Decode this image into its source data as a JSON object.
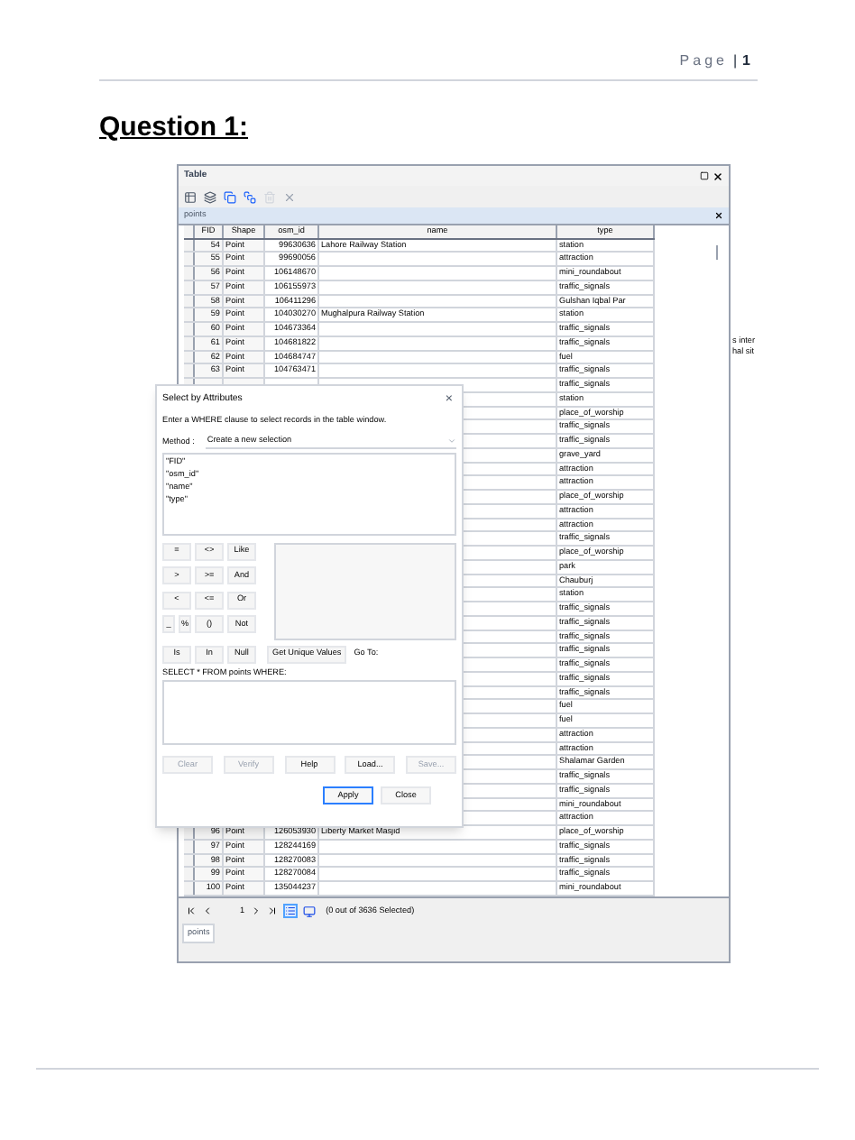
{
  "header": {
    "page_label": "Page",
    "separator": "|",
    "page_number": "1"
  },
  "question_title": "Question 1:",
  "side_text": [
    "s inter",
    "hal sit"
  ],
  "table_window": {
    "title": "Table",
    "layer_tab": "points",
    "columns": [
      "FID",
      "Shape",
      "osm_id",
      "name",
      "type"
    ],
    "rows": [
      {
        "fid": "54",
        "shape": "Point",
        "osm_id": "99630636",
        "name": "Lahore Railway Station",
        "type": "station"
      },
      {
        "fid": "55",
        "shape": "Point",
        "osm_id": "99690056",
        "name": "",
        "type": "attraction"
      },
      {
        "fid": "56",
        "shape": "Point",
        "osm_id": "106148670",
        "name": "",
        "type": "mini_roundabout"
      },
      {
        "fid": "57",
        "shape": "Point",
        "osm_id": "106155973",
        "name": "",
        "type": "traffic_signals"
      },
      {
        "fid": "58",
        "shape": "Point",
        "osm_id": "106411296",
        "name": "",
        "type": "Gulshan Iqbal Par"
      },
      {
        "fid": "59",
        "shape": "Point",
        "osm_id": "104030270",
        "name": "Mughalpura Railway Station",
        "type": "station"
      },
      {
        "fid": "60",
        "shape": "Point",
        "osm_id": "104673364",
        "name": "",
        "type": "traffic_signals"
      },
      {
        "fid": "61",
        "shape": "Point",
        "osm_id": "104681822",
        "name": "",
        "type": "traffic_signals"
      },
      {
        "fid": "62",
        "shape": "Point",
        "osm_id": "104684747",
        "name": "",
        "type": "fuel"
      },
      {
        "fid": "63",
        "shape": "Point",
        "osm_id": "104763471",
        "name": "",
        "type": "traffic_signals"
      },
      {
        "type": "traffic_signals"
      },
      {
        "type": "station"
      },
      {
        "type": "place_of_worship"
      },
      {
        "type": "traffic_signals"
      },
      {
        "type": "traffic_signals"
      },
      {
        "type": "grave_yard"
      },
      {
        "type": "attraction"
      },
      {
        "type": "attraction"
      },
      {
        "type": "place_of_worship"
      },
      {
        "type": "attraction"
      },
      {
        "type": "attraction"
      },
      {
        "type": "traffic_signals"
      },
      {
        "type": "place_of_worship"
      },
      {
        "type": "park"
      },
      {
        "type": "Chauburj"
      },
      {
        "type": "station"
      },
      {
        "type": "traffic_signals"
      },
      {
        "type": "traffic_signals"
      },
      {
        "type": "traffic_signals"
      },
      {
        "type": "traffic_signals"
      },
      {
        "type": "traffic_signals"
      },
      {
        "type": "traffic_signals"
      },
      {
        "type": "traffic_signals"
      },
      {
        "type": "fuel"
      },
      {
        "type": "fuel"
      },
      {
        "type": "attraction"
      },
      {
        "type": "attraction"
      },
      {
        "type": "Shalamar Garden"
      },
      {
        "type": "traffic_signals"
      },
      {
        "type": "traffic_signals"
      },
      {
        "type": "mini_roundabout"
      },
      {
        "type": "attraction"
      },
      {
        "fid": "96",
        "shape": "Point",
        "osm_id": "126053930",
        "name": "Liberty Market Masjid",
        "type": "place_of_worship"
      },
      {
        "fid": "97",
        "shape": "Point",
        "osm_id": "128244169",
        "name": "",
        "type": "traffic_signals"
      },
      {
        "fid": "98",
        "shape": "Point",
        "osm_id": "128270083",
        "name": "",
        "type": "traffic_signals"
      },
      {
        "fid": "99",
        "shape": "Point",
        "osm_id": "128270084",
        "name": "",
        "type": "traffic_signals"
      },
      {
        "fid": "100",
        "shape": "Point",
        "osm_id": "135044237",
        "name": "",
        "type": "mini_roundabout"
      }
    ],
    "nav": {
      "record": "1",
      "status": "(0 out of 3636 Selected)"
    },
    "bottom_tab": "points"
  },
  "dialog": {
    "title": "Select by Attributes",
    "close": "×",
    "instruction": "Enter a WHERE clause to select records in the table window.",
    "method_label": "Method :",
    "method_value": "Create a new selection",
    "fields": [
      "\"FID\"",
      "\"osm_id\"",
      "\"name\"",
      "\"type\""
    ],
    "operator_rows": [
      [
        "=",
        "<>",
        "Like"
      ],
      [
        ">",
        ">=",
        "And"
      ],
      [
        "<",
        "<=",
        "Or"
      ],
      [
        "_",
        "%",
        "()",
        "Not"
      ],
      [
        "Is",
        "In",
        "Null"
      ]
    ],
    "unique_values_button": "Get Unique Values",
    "goto_label": "Go To:",
    "query_label": "SELECT * FROM points WHERE:",
    "buttons": [
      {
        "label": "Clear",
        "disabled": true
      },
      {
        "label": "Verify",
        "disabled": true
      },
      {
        "label": "Help",
        "disabled": false
      },
      {
        "label": "Load...",
        "disabled": false
      },
      {
        "label": "Save...",
        "disabled": true
      }
    ],
    "footer_buttons": [
      {
        "label": "Apply",
        "default": true
      },
      {
        "label": "Close",
        "default": false
      }
    ]
  }
}
